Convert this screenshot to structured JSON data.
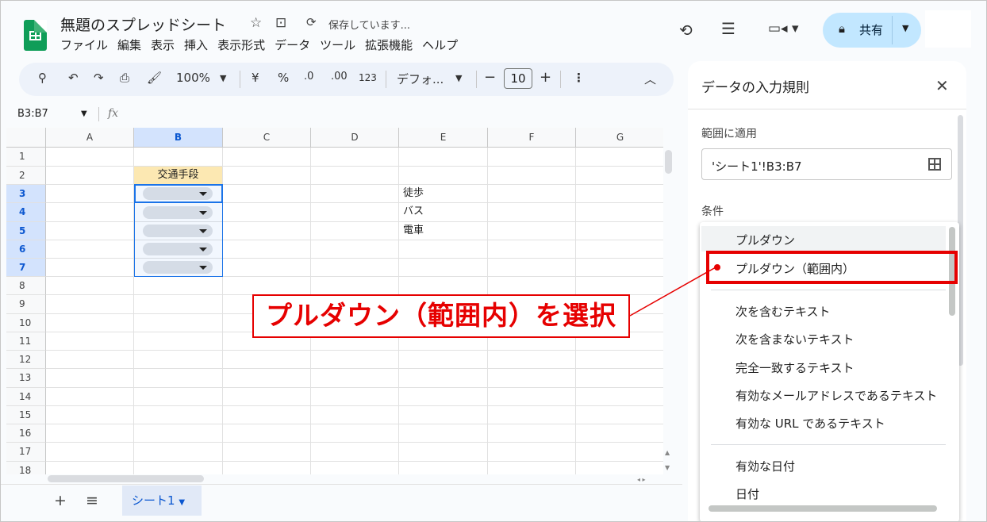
{
  "header": {
    "title": "無題のスプレッドシート",
    "saving": "保存しています...",
    "menu": [
      "ファイル",
      "編集",
      "表示",
      "挿入",
      "表示形式",
      "データ",
      "ツール",
      "拡張機能",
      "ヘルプ"
    ],
    "share_label": "共有"
  },
  "toolbar": {
    "zoom": "100%",
    "currency": "¥",
    "percent": "%",
    "dec_dec": ".0",
    "dec_inc": ".00",
    "format123": "123",
    "font": "デフォ...",
    "font_size": "10"
  },
  "formula_bar": {
    "name_box": "B3:B7",
    "fx": "fx"
  },
  "grid": {
    "columns": [
      "A",
      "B",
      "C",
      "D",
      "E",
      "F",
      "G"
    ],
    "rows": [
      "1",
      "2",
      "3",
      "4",
      "5",
      "6",
      "7",
      "8",
      "9",
      "10",
      "11",
      "12",
      "13",
      "14",
      "15",
      "16",
      "17",
      "18"
    ],
    "b2": "交通手段",
    "e3": "徒歩",
    "e4": "バス",
    "e5": "電車"
  },
  "sheet_tab": "シート1",
  "panel": {
    "title": "データの入力規則",
    "range_label": "範囲に適用",
    "range_value": "'シート1'!B3:B7",
    "condition_label": "条件",
    "options": [
      "プルダウン",
      "プルダウン（範囲内）",
      "次を含むテキスト",
      "次を含まないテキスト",
      "完全一致するテキスト",
      "有効なメールアドレスであるテキスト",
      "有効な URL であるテキスト",
      "有効な日付",
      "日付"
    ]
  },
  "annotation": "プルダウン（範囲内）を選択",
  "colors": {
    "accent": "#0b57d0",
    "share_bg": "#c2e7ff",
    "annotation": "#e60000",
    "sheets_green": "#0f9d58"
  }
}
